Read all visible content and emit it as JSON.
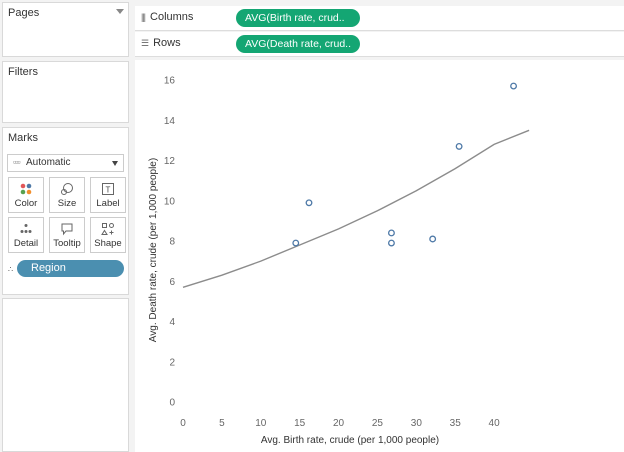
{
  "left_panel": {
    "pages_title": "Pages",
    "filters_title": "Filters",
    "marks": {
      "title": "Marks",
      "mark_type": "Automatic",
      "buttons": [
        {
          "label": "Color",
          "icon": "color-dots-icon"
        },
        {
          "label": "Size",
          "icon": "size-icon"
        },
        {
          "label": "Label",
          "icon": "label-icon"
        },
        {
          "label": "Detail",
          "icon": "detail-icon"
        },
        {
          "label": "Tooltip",
          "icon": "tooltip-icon"
        },
        {
          "label": "Shape",
          "icon": "shape-icon"
        }
      ],
      "detail_pill": "Region"
    }
  },
  "shelves": {
    "columns": {
      "label": "Columns",
      "pill": "AVG(Birth rate, crud.."
    },
    "rows": {
      "label": "Rows",
      "pill": "AVG(Death rate, crud.."
    }
  },
  "colors": {
    "pill_green": "#14a673",
    "detail_blue": "#4b8fb0",
    "point_stroke": "#4e79a7",
    "trend_line": "#8c8c8c"
  },
  "chart_data": {
    "type": "scatter",
    "xlabel": "Avg. Birth rate, crude (per 1,000 people)",
    "ylabel": "Avg. Death rate, crude (per 1,000 people)",
    "xlim": [
      0,
      45
    ],
    "ylim": [
      0,
      16
    ],
    "x_ticks": [
      0,
      5,
      10,
      15,
      20,
      25,
      30,
      35,
      40
    ],
    "y_ticks": [
      0,
      2,
      4,
      6,
      8,
      10,
      12,
      14,
      16
    ],
    "x": [
      14.5,
      16.2,
      26.8,
      26.8,
      32.1,
      35.5,
      42.5
    ],
    "y": [
      7.9,
      9.9,
      8.4,
      7.9,
      8.1,
      12.7,
      15.7
    ],
    "trend": [
      {
        "x": 0,
        "y": 5.7
      },
      {
        "x": 5,
        "y": 6.3
      },
      {
        "x": 10,
        "y": 7.0
      },
      {
        "x": 15,
        "y": 7.8
      },
      {
        "x": 20,
        "y": 8.6
      },
      {
        "x": 25,
        "y": 9.5
      },
      {
        "x": 30,
        "y": 10.5
      },
      {
        "x": 35,
        "y": 11.6
      },
      {
        "x": 40,
        "y": 12.8
      },
      {
        "x": 44.5,
        "y": 13.5
      }
    ],
    "grid": false
  }
}
